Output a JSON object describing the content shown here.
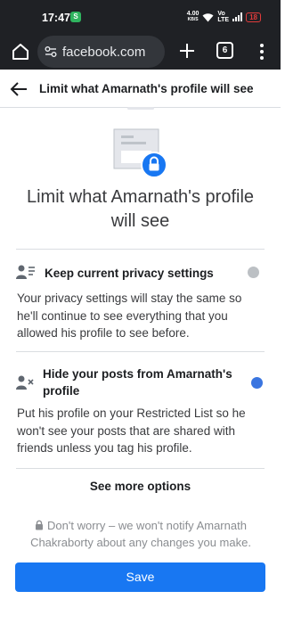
{
  "status_bar": {
    "time": "17:47",
    "app_badge": "S",
    "net_speed_top": "4.00",
    "net_speed_unit": "KB/S",
    "volte_top": "Vo",
    "volte_bottom": "LTE",
    "battery": "18"
  },
  "browser": {
    "url": "facebook.com",
    "tab_count": "6"
  },
  "header": {
    "title": "Limit what Amarnath's profile will see"
  },
  "main": {
    "title": "Limit what Amarnath's profile will see",
    "options": [
      {
        "title": "Keep current privacy settings",
        "description": "Your privacy settings will stay the same so he'll continue to see everything that you allowed his profile to see before.",
        "selected": false
      },
      {
        "title": "Hide your posts from Amarnath's profile",
        "description": "Put his profile on your Restricted List so he won't see your posts that are shared with friends unless you tag his profile.",
        "selected": true
      }
    ],
    "see_more": "See more options",
    "notice": "Don't worry – we won't notify Amarnath Chakraborty about any changes you make.",
    "save_label": "Save"
  },
  "colors": {
    "accent": "#1877f2",
    "radio_selected": "#3a75e0",
    "radio_unselected": "#bcc0c4",
    "dark_chrome": "#1f2125"
  },
  "icons": {
    "home": "home-icon",
    "site_settings": "tune-icon",
    "new_tab": "plus-icon",
    "tabs": "tab-switcher-icon",
    "menu": "more-vert-icon",
    "back": "arrow-left-icon",
    "option1": "person-list-icon",
    "option2": "person-x-icon",
    "notice": "lock-icon"
  }
}
